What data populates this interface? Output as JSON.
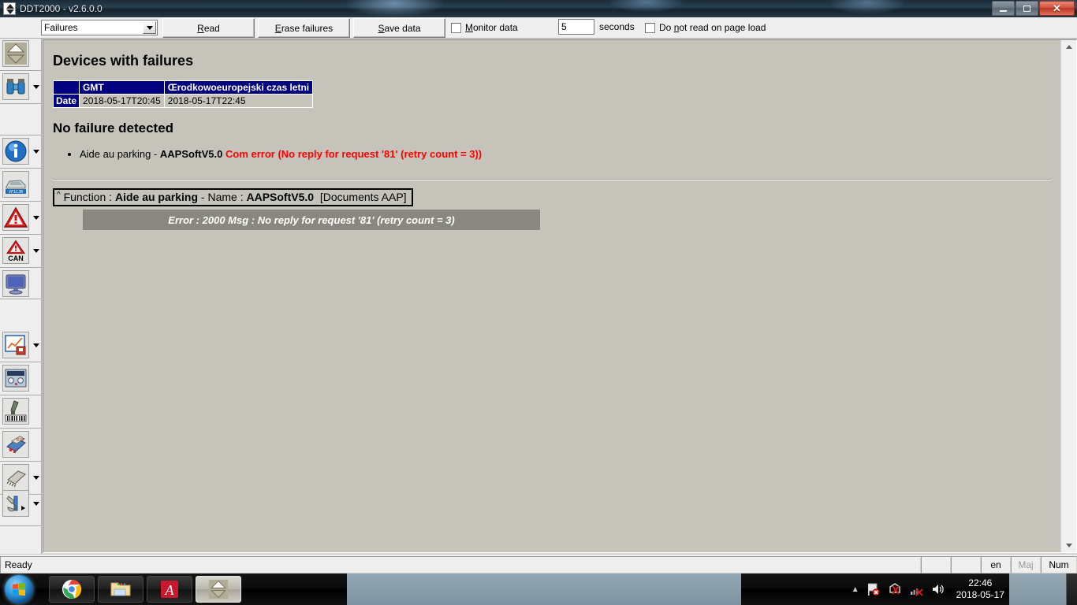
{
  "window": {
    "title": "DDT2000 - v2.6.0.0",
    "app_icon": "updown-triangles-icon",
    "buttons": {
      "minimize": "minimize-icon",
      "restore": "restore-icon",
      "close": "close-icon"
    }
  },
  "toolbar": {
    "mode_select": {
      "value": "Failures",
      "placeholder": "Failures"
    },
    "read_button": {
      "prefix": "",
      "accel": "R",
      "rest": "ead"
    },
    "erase_button": {
      "accel": "E",
      "rest": "rase failures"
    },
    "save_button": {
      "accel": "S",
      "rest": "ave data"
    },
    "monitor_checkbox": {
      "accel": "M",
      "rest": "onitor data",
      "checked": false
    },
    "interval_value": "5",
    "interval_unit": "seconds",
    "no_read_checkbox": {
      "pre": "Do ",
      "accel": "n",
      "rest": "ot read on page load",
      "checked": false
    }
  },
  "sidebar": {
    "items": [
      {
        "name": "updown-triangles-icon",
        "caret": false
      },
      {
        "name": "binoculars-icon",
        "caret": true
      },
      {
        "name": "info-icon",
        "caret": true
      },
      {
        "name": "car-vin-icon",
        "caret": false
      },
      {
        "name": "warning-triangle-icon",
        "caret": true
      },
      {
        "name": "can-warning-icon",
        "caret": true,
        "label": "CAN"
      },
      {
        "name": "monitor-icon",
        "caret": false
      },
      {
        "name": "chart-save-icon",
        "caret": true
      },
      {
        "name": "control-panel-icon",
        "caret": false
      },
      {
        "name": "barcode-scanner-icon",
        "caret": false
      },
      {
        "name": "chip-programmer-icon",
        "caret": false
      },
      {
        "name": "memory-chip-icon",
        "caret": true
      },
      {
        "name": "tools-icon",
        "caret": true
      }
    ]
  },
  "page": {
    "heading": "Devices with failures",
    "date_table": {
      "corner": "",
      "columns": [
        "GMT",
        "Œrodkowoeuropejski czas letni"
      ],
      "row_header": "Date",
      "values": [
        "2018-05-17T20:45",
        "2018-05-17T22:45"
      ]
    },
    "subheading": "No failure detected",
    "failures": [
      {
        "device": "Aide au parking - ",
        "software": "AAPSoftV5.0",
        "error": "Com error (No reply for request '81' (retry count = 3))"
      }
    ],
    "function_box": {
      "caret": "^",
      "function_label": "Function :",
      "function_name": "Aide au parking",
      "separator": "- ",
      "name_label": "Name :",
      "name_value": "AAPSoftV5.0",
      "documents": "[Documents AAP]"
    },
    "error_bar": "Error : 2000 Msg : No reply for request '81' (retry count = 3)"
  },
  "statusbar": {
    "message": "Ready",
    "pane_blank1": "",
    "pane_blank2": "",
    "language": "en",
    "caps": "Maj",
    "num": "Num"
  },
  "taskbar": {
    "start": "windows-start-icon",
    "buttons": [
      {
        "name": "chrome-taskbar-icon",
        "active": false
      },
      {
        "name": "explorer-taskbar-icon",
        "active": false
      },
      {
        "name": "acrobat-taskbar-icon",
        "active": false
      },
      {
        "name": "ddt2000-taskbar-icon",
        "active": true
      }
    ],
    "tray": {
      "overflow": "show-hidden-icons-icon",
      "action_center": "flag-error-icon",
      "network": "network-disconnected-icon",
      "signal": "signal-none-icon",
      "volume": "volume-icon",
      "time": "22:46",
      "date": "2018-05-17"
    }
  },
  "colors": {
    "content_bg": "#c6c3bb",
    "table_header": "#000080",
    "error_red": "#ff0000",
    "error_bar_bg": "#898780"
  }
}
